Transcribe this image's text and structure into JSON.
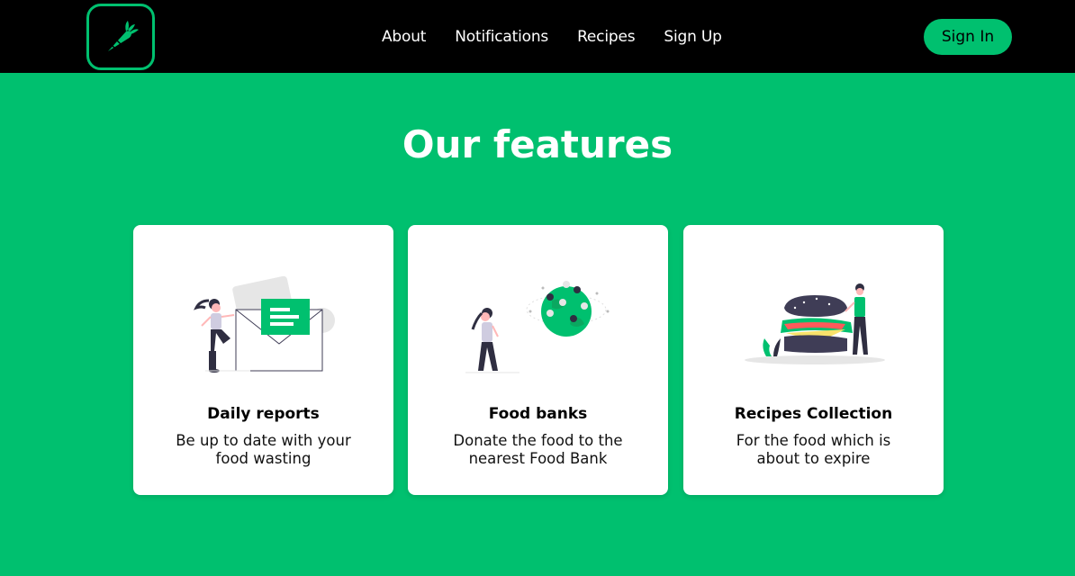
{
  "nav": {
    "logo_icon": "carrot-icon",
    "links": [
      "About",
      "Notifications",
      "Recipes",
      "Sign Up"
    ],
    "signin_label": "Sign In"
  },
  "features": {
    "heading": "Our features",
    "cards": [
      {
        "title": "Daily reports",
        "description": "Be up to date with your food wasting",
        "illustration": "envelope-report-illustration"
      },
      {
        "title": "Food banks",
        "description": "Donate the food to the nearest Food Bank",
        "illustration": "globe-map-illustration"
      },
      {
        "title": "Recipes Collection",
        "description": "For the food which is about to expire",
        "illustration": "burger-illustration"
      }
    ]
  },
  "colors": {
    "brand_green": "#00c06f",
    "navbar_bg": "#000000",
    "card_bg": "#ffffff"
  }
}
